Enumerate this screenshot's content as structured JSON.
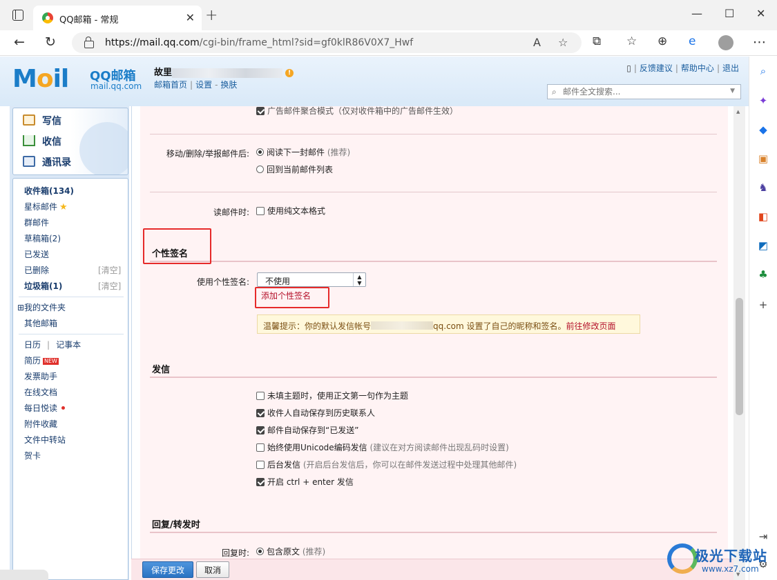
{
  "browser": {
    "tab_title": "QQ邮箱 - 常规",
    "url_host": "https://mail.qq.com",
    "url_path": "/cgi-bin/frame_html?sid=gf0klR86V0X7_Hwf"
  },
  "header": {
    "logo_text": "M",
    "logo_text_o": "o",
    "logo_text_il": "il",
    "brand": "QQ邮箱",
    "brand_domain": "mail.qq.com",
    "account_prefix": "故里",
    "links": {
      "home": "邮箱首页",
      "settings": "设置",
      "switch": "换肤"
    },
    "top_links": {
      "feedback": "反馈建议",
      "help": "帮助中心",
      "logout": "退出"
    },
    "search_placeholder": "邮件全文搜索..."
  },
  "sidebar": {
    "actions": {
      "compose": "写信",
      "inbox": "收信",
      "contacts": "通讯录"
    },
    "folders": {
      "inbox": "收件箱(134)",
      "starred": "星标邮件",
      "group": "群邮件",
      "drafts": "草稿箱(2)",
      "sent": "已发送",
      "deleted": "已删除",
      "deleted_clear": "[清空]",
      "spam": "垃圾箱(1)",
      "spam_clear": "[清空]",
      "my_folders": "⊞我的文件夹",
      "other_mail": "其他邮箱",
      "calendar": "日历",
      "notebook": "记事本",
      "resume": "简历",
      "resume_badge": "NEW",
      "invoice": "发票助手",
      "docs": "在线文档",
      "daily": "每日悦读",
      "attachments": "附件收藏",
      "transfer": "文件中转站",
      "cards": "贺卡"
    }
  },
  "settings": {
    "truncated_line": "广告邮件聚合模式（仅对收件箱中的广告邮件生效）",
    "after_action_label": "移动/删除/举报邮件后:",
    "after_action_opt1": "阅读下一封邮件",
    "after_action_opt1_hint": "(推荐)",
    "after_action_opt2": "回到当前邮件列表",
    "read_label": "读邮件时:",
    "read_opt": "使用纯文本格式",
    "signature_section": "个性签名",
    "signature_label": "使用个性签名:",
    "signature_value": "不使用",
    "add_signature": "添加个性签名",
    "tip_prefix": "温馨提示：你的默认发信帐号",
    "tip_domain": "qq.com",
    "tip_middle": " 设置了自己的昵称和签名。",
    "tip_link": "前往修改页面",
    "send_section": "发信",
    "send_opts": [
      {
        "label": "未填主题时，使用正文第一句作为主题",
        "hint": "",
        "checked": false
      },
      {
        "label": "收件人自动保存到历史联系人",
        "hint": "",
        "checked": true
      },
      {
        "label": "邮件自动保存到“已发送”",
        "hint": "",
        "checked": true
      },
      {
        "label": "始终使用Unicode编码发信",
        "hint": " (建议在对方阅读邮件出现乱码时设置)",
        "checked": false
      },
      {
        "label": "后台发信",
        "hint": " (开启后台发信后，你可以在邮件发送过程中处理其他邮件)",
        "checked": false
      },
      {
        "label": "开启 ctrl + enter 发信",
        "hint": "",
        "checked": true
      }
    ],
    "reply_section": "回复/转发时",
    "reply_label": "回复时:",
    "reply_opt": "包含原文",
    "reply_opt_hint": "(推荐)"
  },
  "footer": {
    "save": "保存更改",
    "cancel": "取消"
  },
  "watermark": {
    "title": "极光下载站",
    "url": "www.xz7.com"
  }
}
